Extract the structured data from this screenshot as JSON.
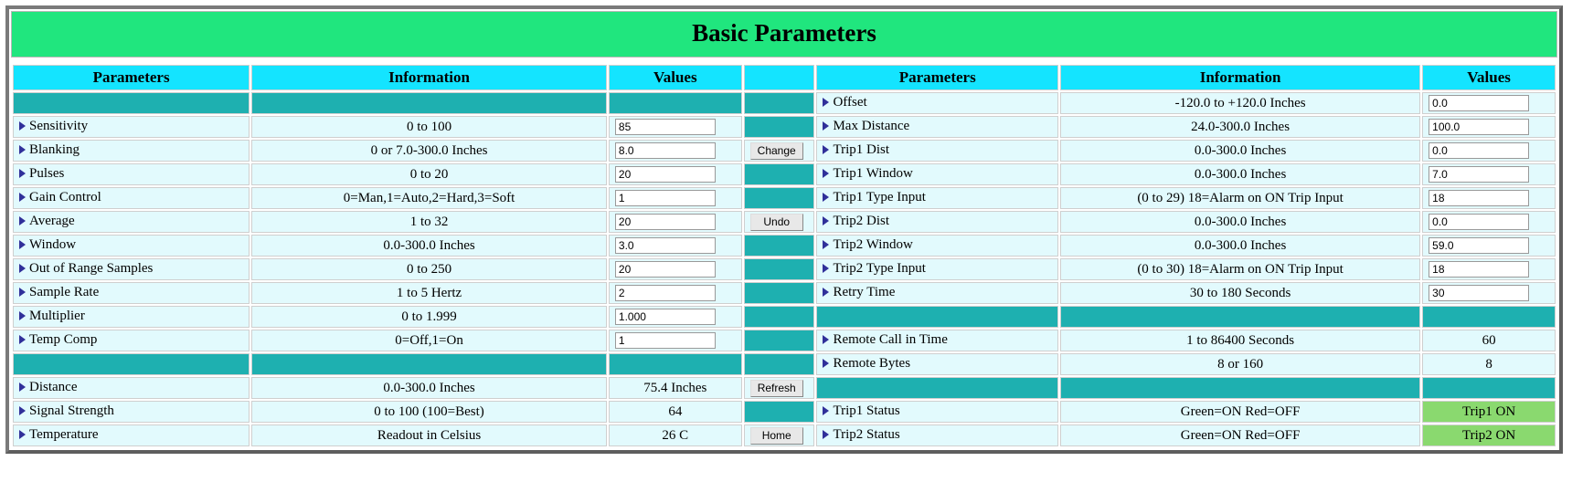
{
  "title": "Basic Parameters",
  "headers": {
    "parameters": "Parameters",
    "information": "Information",
    "values": "Values"
  },
  "buttons": {
    "change": "Change",
    "undo": "Undo",
    "refresh": "Refresh",
    "home": "Home"
  },
  "left": {
    "sensitivity": {
      "label": "Sensitivity",
      "info": "0 to 100",
      "value": "85"
    },
    "blanking": {
      "label": "Blanking",
      "info": "0 or 7.0-300.0 Inches",
      "value": "8.0"
    },
    "pulses": {
      "label": "Pulses",
      "info": "0 to 20",
      "value": "20"
    },
    "gain_control": {
      "label": "Gain Control",
      "info": "0=Man,1=Auto,2=Hard,3=Soft",
      "value": "1"
    },
    "average": {
      "label": "Average",
      "info": "1 to 32",
      "value": "20"
    },
    "window": {
      "label": "Window",
      "info": "0.0-300.0 Inches",
      "value": "3.0"
    },
    "out_of_range": {
      "label": "Out of Range Samples",
      "info": "0 to 250",
      "value": "20"
    },
    "sample_rate": {
      "label": "Sample Rate",
      "info": "1 to 5 Hertz",
      "value": "2"
    },
    "multiplier": {
      "label": "Multiplier",
      "info": "0 to 1.999",
      "value": "1.000"
    },
    "temp_comp": {
      "label": "Temp Comp",
      "info": "0=Off,1=On",
      "value": "1"
    },
    "distance": {
      "label": "Distance",
      "info": "0.0-300.0 Inches",
      "value": "75.4 Inches"
    },
    "signal_strength": {
      "label": "Signal Strength",
      "info": "0 to 100 (100=Best)",
      "value": "64"
    },
    "temperature": {
      "label": "Temperature",
      "info": "Readout in Celsius",
      "value": "26 C"
    }
  },
  "right": {
    "offset": {
      "label": "Offset",
      "info": "-120.0 to +120.0 Inches",
      "value": "0.0"
    },
    "max_distance": {
      "label": "Max Distance",
      "info": "24.0-300.0 Inches",
      "value": "100.0"
    },
    "trip1_dist": {
      "label": "Trip1 Dist",
      "info": "0.0-300.0 Inches",
      "value": "0.0"
    },
    "trip1_window": {
      "label": "Trip1 Window",
      "info": "0.0-300.0 Inches",
      "value": "7.0"
    },
    "trip1_type": {
      "label": "Trip1 Type Input",
      "info": "(0 to 29) 18=Alarm on ON Trip Input",
      "value": "18"
    },
    "trip2_dist": {
      "label": "Trip2 Dist",
      "info": "0.0-300.0 Inches",
      "value": "0.0"
    },
    "trip2_window": {
      "label": "Trip2 Window",
      "info": "0.0-300.0 Inches",
      "value": "59.0"
    },
    "trip2_type": {
      "label": "Trip2 Type Input",
      "info": "(0 to 30) 18=Alarm on ON Trip Input",
      "value": "18"
    },
    "retry_time": {
      "label": "Retry Time",
      "info": "30 to 180 Seconds",
      "value": "30"
    },
    "remote_call": {
      "label": "Remote Call in Time",
      "info": "1 to 86400 Seconds",
      "value": "60"
    },
    "remote_bytes": {
      "label": "Remote Bytes",
      "info": "8 or 160",
      "value": "8"
    },
    "trip1_status": {
      "label": "Trip1 Status",
      "info": "Green=ON Red=OFF",
      "value": "Trip1 ON"
    },
    "trip2_status": {
      "label": "Trip2 Status",
      "info": "Green=ON Red=OFF",
      "value": "Trip2 ON"
    }
  }
}
